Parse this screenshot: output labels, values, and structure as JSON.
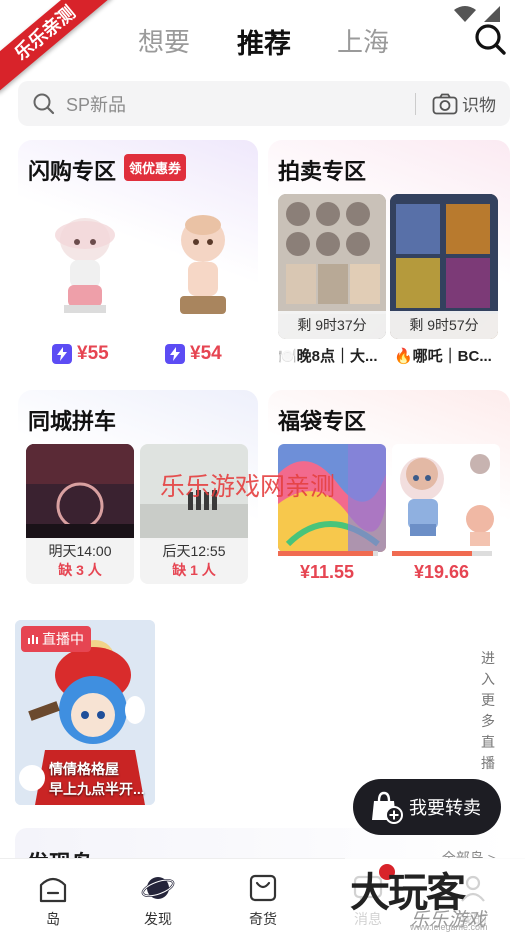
{
  "watermarks": {
    "ribbon": "乐乐亲测",
    "center": "乐乐游戏网亲测",
    "brand": "大玩客",
    "brand_sub": "乐乐游戏",
    "brand_url": "www.lelegame.com"
  },
  "header": {
    "tabs": [
      {
        "label": "想要",
        "active": false
      },
      {
        "label": "推荐",
        "active": true
      },
      {
        "label": "上海",
        "active": false
      }
    ]
  },
  "search": {
    "placeholder": "SP新品",
    "identify_label": "识物"
  },
  "flash_sale": {
    "title": "闪购专区",
    "coupon": "领优惠券",
    "prices": [
      "¥55",
      "¥54"
    ]
  },
  "auction": {
    "title": "拍卖专区",
    "items": [
      {
        "remaining": "剩 9时37分",
        "desc": "🍽️晚8点｜大..."
      },
      {
        "remaining": "剩 9时57分",
        "desc": "🔥哪吒｜BC..."
      }
    ]
  },
  "carpool": {
    "title": "同城拼车",
    "items": [
      {
        "time": "明天14:00",
        "need": "缺 3 人"
      },
      {
        "time": "后天12:55",
        "need": "缺 1 人"
      }
    ]
  },
  "lucky_bag": {
    "title": "福袋专区",
    "items": [
      {
        "price": "¥11.55",
        "progress": 0.95
      },
      {
        "price": "¥19.66",
        "progress": 0.8
      }
    ]
  },
  "live": {
    "badge": "直播中",
    "name": "情倩格格屋",
    "subtitle": "早上九点半开...",
    "more": "进入更多直播"
  },
  "sell_button": "我要转卖",
  "discover": {
    "title": "发现岛",
    "all": "全部岛 >"
  },
  "bottom_nav": [
    {
      "label": "岛",
      "icon": "island-icon"
    },
    {
      "label": "发现",
      "icon": "planet-icon"
    },
    {
      "label": "奇货",
      "icon": "bag-icon"
    },
    {
      "label": "消息",
      "icon": "message-icon"
    },
    {
      "label": "我的",
      "icon": "profile-icon"
    }
  ],
  "colors": {
    "accent_red": "#e64552",
    "flash_bolt": "#5c4cf4",
    "sell_button_bg": "#1d1d23"
  }
}
